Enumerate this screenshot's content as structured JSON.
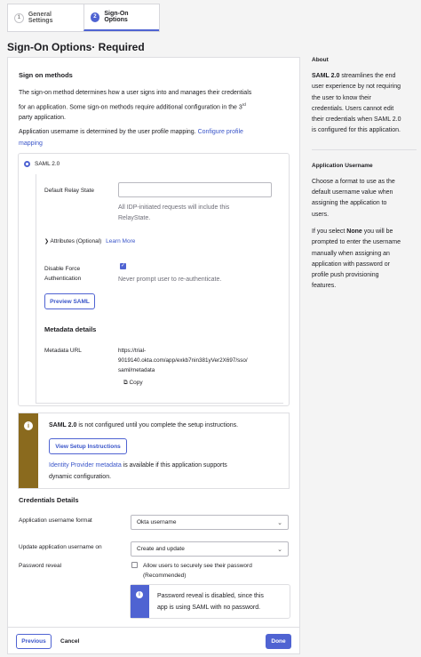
{
  "tabs": [
    {
      "num": "1",
      "label": "General Settings"
    },
    {
      "num": "2",
      "label": "Sign-On Options"
    }
  ],
  "page_title": "Sign-On Options· Required",
  "sign_on": {
    "title": "Sign on methods",
    "desc_1": "The sign-on method determines how a user signs into and manages their credentials",
    "desc_2": "for an application. Some sign-on methods require additional configuration in the 3",
    "desc_2_sup": "rd",
    "desc_3": "party application.",
    "username_text": "Application username is determined by the user profile mapping.",
    "username_link_1": "Configure profile",
    "username_link_2": "mapping",
    "saml_label": "SAML 2.0"
  },
  "saml": {
    "relay_label": "Default Relay State",
    "relay_value": "",
    "relay_help_1": "All IDP-initiated requests will include this",
    "relay_help_2": "RelayState.",
    "attributes_icon": "chevron-right-icon",
    "attributes_label": "Attributes (Optional)",
    "attributes_link": "Learn More",
    "force_auth_label_1": "Disable Force",
    "force_auth_label_2": "Authentication",
    "force_auth_checked": true,
    "force_auth_help": "Never prompt user to re-authenticate.",
    "preview_button": "Preview SAML",
    "metadata_title": "Metadata details",
    "metadata_url_label": "Metadata URL",
    "metadata_url_1": "https://trial-",
    "metadata_url_2": "9019140.okta.com/app/exkb7nin381yVer2X697/sso/",
    "metadata_url_3": "saml/metadata",
    "copy_label": "Copy",
    "copy_icon": "copy-icon"
  },
  "callout": {
    "icon": "info-icon",
    "title_bold": "SAML 2.0",
    "title_rest": " is not configured until you complete the setup instructions.",
    "button": "View Setup Instructions",
    "link": "Identity Provider metadata",
    "text_rest": " is available if this application supports",
    "text_2": "dynamic configuration."
  },
  "credentials": {
    "title": "Credentials Details",
    "format_label": "Application username format",
    "format_value": "Okta username",
    "update_label": "Update application username on",
    "update_value": "Create and update",
    "reveal_label": "Password reveal",
    "reveal_checked": false,
    "reveal_text_1": "Allow users to securely see their password",
    "reveal_text_2": "(Recommended)",
    "info_text_1": "Password reveal is disabled, since this",
    "info_text_2": "app is using SAML with no password."
  },
  "footer": {
    "previous": "Previous",
    "cancel": "Cancel",
    "done": "Done"
  },
  "about": {
    "title": "About",
    "bold": "SAML 2.0",
    "lines": [
      " streamlines the end",
      "user experience by not requiring",
      "the user to know their",
      "credentials. Users cannot edit",
      "their credentials when SAML 2.0",
      "is configured for this application."
    ],
    "username_title": "Application Username",
    "username_lines": [
      "Choose a format to use as the",
      "default username value when",
      "assigning the application to",
      "users."
    ],
    "none_prefix": "If you select ",
    "none_bold": "None",
    "none_rest": " you will be",
    "none_lines": [
      "prompted to enter the username",
      "manually when assigning an",
      "application with password or",
      "profile push provisioning",
      "features."
    ]
  },
  "colors": {
    "accent": "#4f63d2",
    "warning": "#8a6a1e",
    "link": "#3a55c9"
  }
}
